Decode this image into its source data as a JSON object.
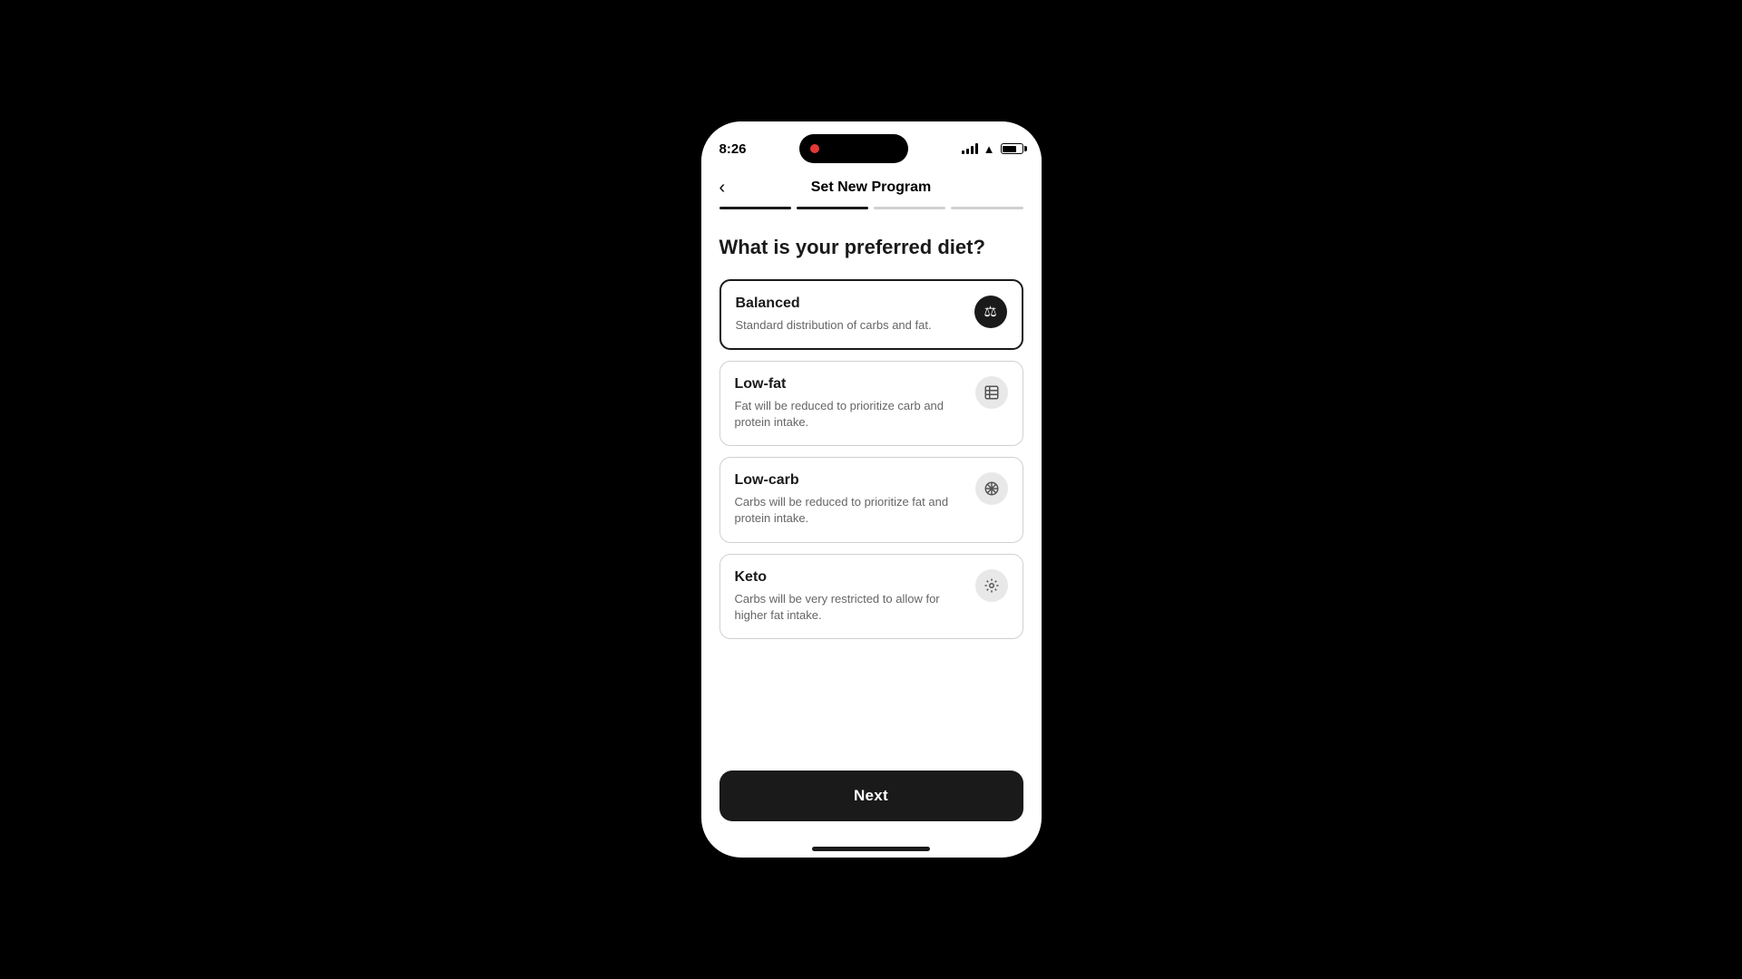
{
  "statusBar": {
    "time": "8:26",
    "batteryLevel": 75
  },
  "navBar": {
    "title": "Set New Program",
    "backLabel": "‹"
  },
  "progressSteps": [
    {
      "state": "active"
    },
    {
      "state": "active"
    },
    {
      "state": "inactive"
    },
    {
      "state": "inactive"
    }
  ],
  "question": "What is your preferred diet?",
  "dietOptions": [
    {
      "id": "balanced",
      "title": "Balanced",
      "description": "Standard distribution of carbs and fat.",
      "icon": "⚖",
      "selected": true,
      "iconTheme": "dark"
    },
    {
      "id": "low-fat",
      "title": "Low-fat",
      "description": "Fat will be reduced to prioritize carb and protein intake.",
      "icon": "🥗",
      "selected": false,
      "iconTheme": "light"
    },
    {
      "id": "low-carb",
      "title": "Low-carb",
      "description": "Carbs will be reduced to prioritize fat and protein intake.",
      "icon": "⊞",
      "selected": false,
      "iconTheme": "light"
    },
    {
      "id": "keto",
      "title": "Keto",
      "description": "Carbs will be very restricted to allow for higher fat intake.",
      "icon": "⚙",
      "selected": false,
      "iconTheme": "light"
    }
  ],
  "nextButton": {
    "label": "Next"
  }
}
